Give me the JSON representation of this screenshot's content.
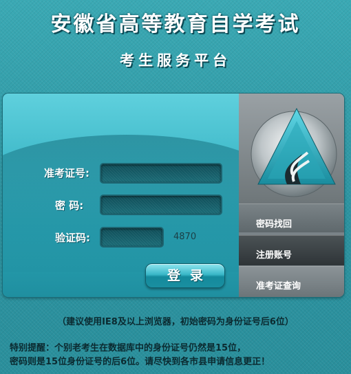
{
  "header": {
    "title": "安徽省高等教育自学考试",
    "subtitle": "考生服务平台"
  },
  "login": {
    "exam_id_label": "准考证号:",
    "password_label": "密 码:",
    "captcha_label": "验证码:",
    "exam_id_value": "",
    "password_value": "",
    "captcha_value": "",
    "captcha_code": "4870",
    "submit_label": "登录"
  },
  "sidebar": {
    "items": [
      {
        "label": "密码找回"
      },
      {
        "label": "注册账号"
      },
      {
        "label": "准考证查询"
      }
    ]
  },
  "notice": {
    "browser_tip": "（建议使用IE8及以上浏览器，初始密码为身份证号后6位）",
    "special_line1": "特别提醒：个别老考生在数据库中的身份证号仍然是15位，",
    "special_line2": "密码则是15位身份证号的后6位。请尽快到各市县申请信息更正！"
  },
  "colors": {
    "background": "#2f9aa6",
    "panel": "#3fb9c9",
    "sidebar": "#7d868a",
    "text_dark": "#0b2a30"
  }
}
